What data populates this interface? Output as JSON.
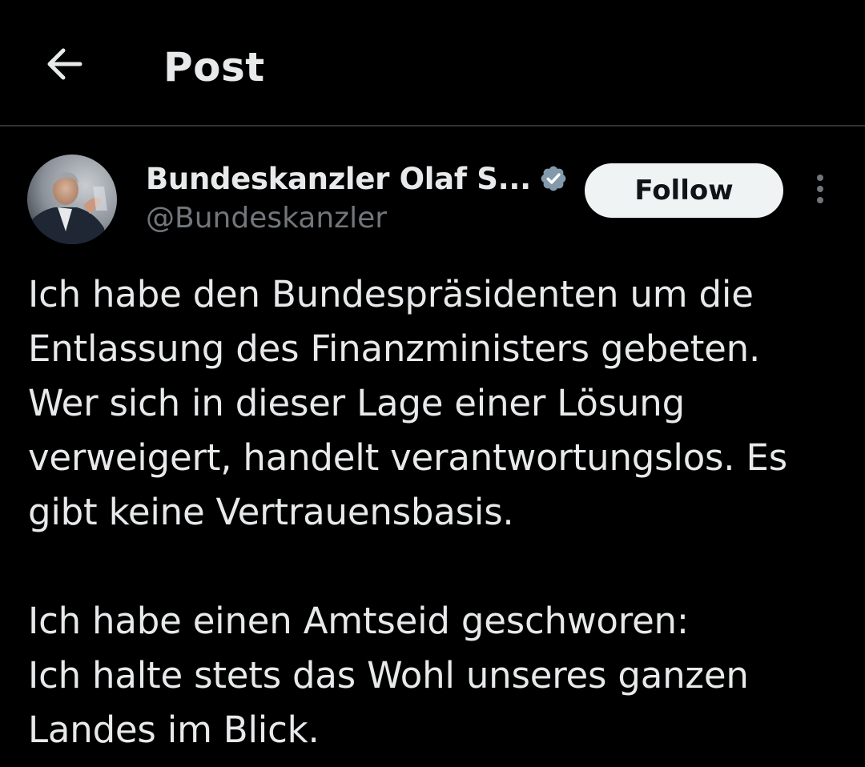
{
  "header": {
    "back_icon": "arrow-left-icon",
    "title": "Post"
  },
  "post": {
    "author": {
      "name": "Bundeskanzler Olaf S...",
      "handle": "@Bundeskanzler",
      "verified_icon": "verified-badge-icon",
      "verified_color": "#829aab"
    },
    "follow_label": "Follow",
    "more_icon": "more-vertical-icon",
    "paragraphs": [
      "Ich habe den Bundespräsidenten um die\nEntlassung des Finanzministers gebeten.\nWer sich in dieser Lage einer Lösung\nverweigert, handelt verantwortungslos. Es\ngibt keine Vertrauensbasis.",
      "Ich habe einen Amtseid geschworen:\nIch halte stets das Wohl unseres ganzen\nLandes im Blick."
    ]
  },
  "colors": {
    "background": "#000000",
    "text_primary": "#e7e9ea",
    "text_secondary": "#71767b",
    "divider": "#2f3336",
    "follow_bg": "#eff3f4"
  }
}
